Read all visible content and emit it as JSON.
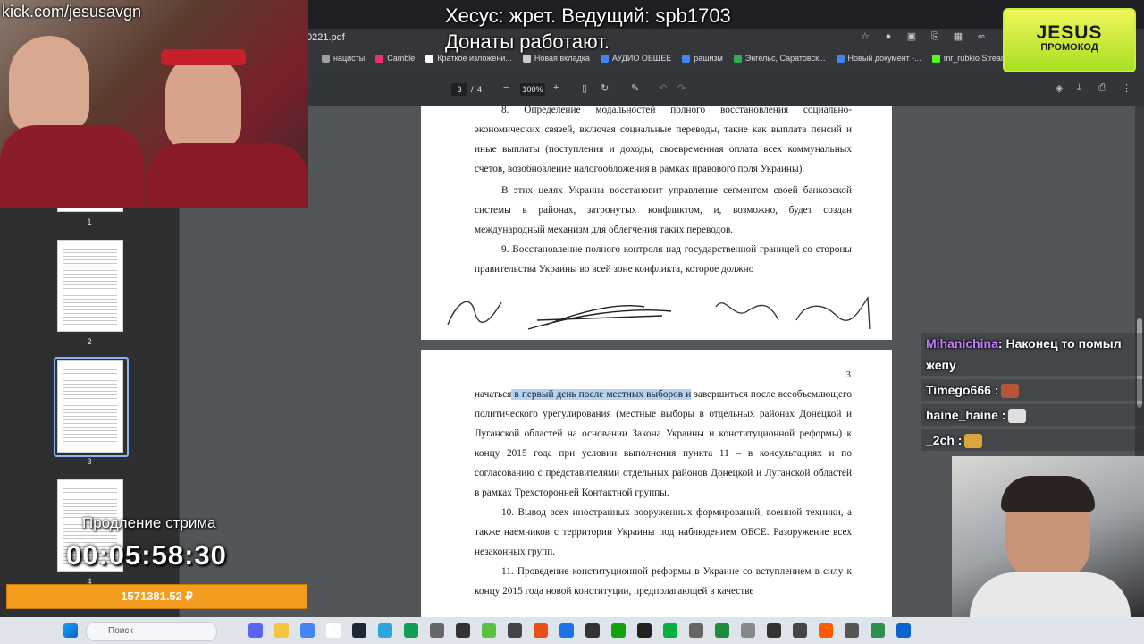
{
  "browser": {
    "url_fragment": "0221.pdf",
    "bookmarks": [
      {
        "label": "нацисты",
        "color": "#9aa0a6"
      },
      {
        "label": "Camble",
        "color": "#e8336f"
      },
      {
        "label": "Краткое изложени...",
        "color": "#ffffff"
      },
      {
        "label": "Новая вкладка",
        "color": "#c9cbcf"
      },
      {
        "label": "АУДИО ОБЩЕЕ",
        "color": "#4285f4"
      },
      {
        "label": "рашизм",
        "color": "#4285f4"
      },
      {
        "label": "Энгельс, Саратовск...",
        "color": "#34a853"
      },
      {
        "label": "Новый документ -...",
        "color": "#4285f4"
      },
      {
        "label": "mr_rubkio Stream -...",
        "color": "#53fc18"
      }
    ]
  },
  "pdf_toolbar": {
    "current_page": "3",
    "separator": "/",
    "total_pages": "4",
    "zoom": "100%"
  },
  "sidebar": {
    "thumbnails": [
      {
        "number": "1"
      },
      {
        "number": "2"
      },
      {
        "number": "3"
      },
      {
        "number": "4"
      }
    ]
  },
  "document": {
    "page2_paragraphs": [
      "8. Определение модальностей полного восстановления социально-экономических связей, включая социальные переводы, такие как выплата пенсий и иные выплаты (поступления и доходы, своевременная оплата всех коммунальных счетов, возобновление налогообложения в рамках правового поля Украины).",
      "В этих целях Украина восстановит управление сегментом своей банковской системы в районах, затронутых конфликтом, и, возможно, будет создан международный механизм для облегчения таких переводов.",
      "9. Восстановление полного контроля над государственной границей со стороны правительства Украины во всей зоне конфликта, которое должно"
    ],
    "page3_number": "3",
    "page3_start": "начаться",
    "page3_highlight": " в первый день после местных выборов и",
    "page3_rest": " завершиться после всеобъемлющего политического урегулирования (местные выборы в отдельных районах Донецкой и Луганской областей на основании Закона Украины и конституционной реформы) к концу 2015 года при условии выполнения пункта 11 – в консультациях и по согласованию с представителями отдельных районов Донецкой и Луганской областей в рамках Трехсторонней Контактной группы.",
    "page3_p10": "10. Вывод всех иностранных вооруженных формирований, военной техники, а также наемников с территории Украины под наблюдением ОБСЕ. Разоружение всех незаконных групп.",
    "page3_p11": "11. Проведение конституционной реформы в Украине со вступлением в силу к концу 2015 года новой конституции, предполагающей в качестве"
  },
  "stream": {
    "handle": "kick.com/jesusavgn",
    "title_line1": "Хесус: жрет. Ведущий: spb1703",
    "title_line2": "Донаты работают.",
    "promo_big": "JESUS",
    "promo_small": "ПРОМОКОД",
    "timer_label": "Продление стрима",
    "timer": "00:05:58:30",
    "donation_total": "1571381.52 ₽"
  },
  "chat": [
    {
      "user": "Mihanichina",
      "color": "#c77dff",
      "text": ": Наконец то помыл жепу"
    },
    {
      "user": "Timego666",
      "color": "#ffffff",
      "text": " :",
      "emote": "#b5553a"
    },
    {
      "user": "haine_haine",
      "color": "#ffffff",
      "text": " :",
      "emote": "#e0e0e0"
    },
    {
      "user": "_2ch",
      "color": "#ffffff",
      "text": " :",
      "emote": "#d9a53c"
    }
  ],
  "taskbar": {
    "search_placeholder": "Поиск"
  }
}
